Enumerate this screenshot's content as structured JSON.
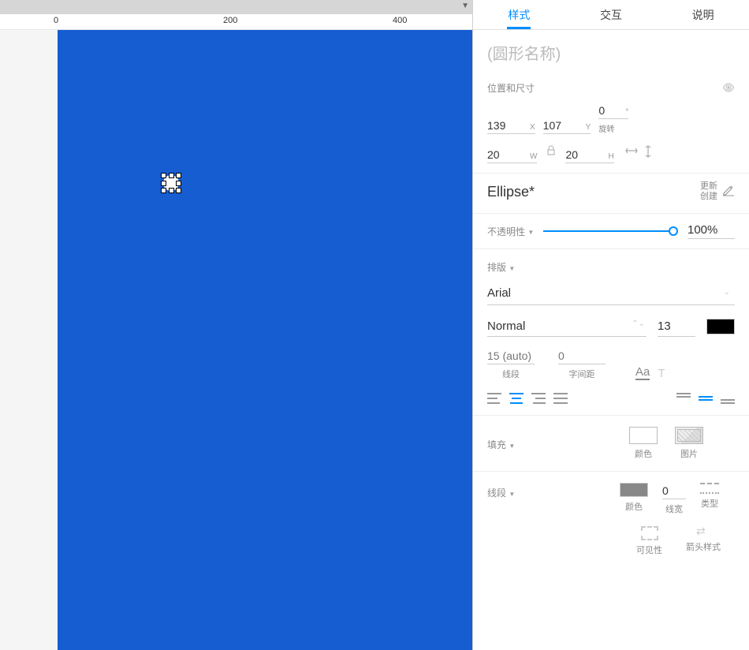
{
  "tabs": {
    "style": "样式",
    "interaction": "交互",
    "notes": "说明"
  },
  "shape_name_placeholder": "(圆形名称)",
  "pos_size": {
    "title": "位置和尺寸",
    "x": "139",
    "x_label": "X",
    "y": "107",
    "y_label": "Y",
    "rot": "0",
    "rot_unit": "°",
    "rot_label": "旋转",
    "w": "20",
    "w_label": "W",
    "h": "20",
    "h_label": "H"
  },
  "style_name": "Ellipse*",
  "style_actions": {
    "update": "更新",
    "create": "创建"
  },
  "opacity": {
    "label": "不透明性",
    "value": "100%"
  },
  "typo": {
    "title": "排版",
    "font": "Arial",
    "weight": "Normal",
    "size": "13",
    "line_height_placeholder": "15 (auto)",
    "line_height_label": "线段",
    "letter_spacing_placeholder": "0",
    "letter_spacing_label": "字间距",
    "case_aa": "Aa"
  },
  "fill": {
    "title": "填充",
    "color": "颜色",
    "image": "图片"
  },
  "line": {
    "title": "线段",
    "color": "颜色",
    "width_val": "0",
    "width": "线宽",
    "type": "类型",
    "visibility": "可见性",
    "arrow": "箭头样式"
  },
  "ruler": {
    "t0": "0",
    "t200": "200",
    "t400": "400"
  }
}
